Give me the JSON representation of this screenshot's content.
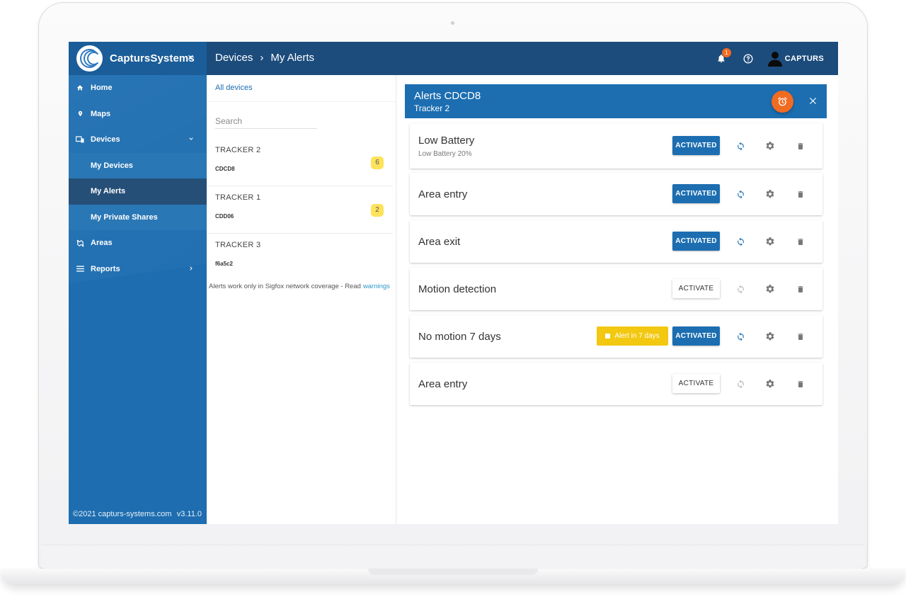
{
  "brand": {
    "name": "CaptursSystems",
    "close_glyph": "×"
  },
  "breadcrumb": {
    "items": [
      "Devices",
      "My Alerts"
    ],
    "separator": "›"
  },
  "topbar": {
    "notification_count": "1",
    "user_name": "CAPTURS"
  },
  "sidebar": {
    "items": [
      {
        "label": "Home",
        "icon": "home-icon"
      },
      {
        "label": "Maps",
        "icon": "map-pin-icon"
      },
      {
        "label": "Devices",
        "icon": "devices-icon"
      },
      {
        "label": "My Devices"
      },
      {
        "label": "My Alerts"
      },
      {
        "label": "My Private Shares"
      },
      {
        "label": "Areas",
        "icon": "areas-icon"
      },
      {
        "label": "Reports",
        "icon": "menu-lines-icon"
      }
    ],
    "footer_copyright": "©2021 capturs-systems.com",
    "footer_version": "v3.11.0"
  },
  "devices_panel": {
    "all_devices": "All devices",
    "search_placeholder": "Search",
    "devices": [
      {
        "name": "TRACKER 2",
        "id": "CDCD8",
        "alerts": "6"
      },
      {
        "name": "TRACKER 1",
        "id": "CDD06",
        "alerts": "2"
      },
      {
        "name": "TRACKER 3",
        "id": "f6a5c2"
      }
    ],
    "note": "Alerts work only in Sigfox network coverage - Read",
    "note_link": "warnings"
  },
  "alerts_panel": {
    "title": "Alerts CDCD8",
    "subtitle": "Tracker 2",
    "alerts": [
      {
        "title": "Low Battery",
        "subtitle": "Low Battery 20%",
        "state": "ACTIVATED",
        "active": true
      },
      {
        "title": "Area entry",
        "state": "ACTIVATED",
        "active": true
      },
      {
        "title": "Area exit",
        "state": "ACTIVATED",
        "active": true
      },
      {
        "title": "Motion detection",
        "state": "ACTIVATE",
        "active": false
      },
      {
        "title": "No motion 7 days",
        "pending": "Alert in 7 days",
        "state": "ACTIVATED",
        "active": true
      },
      {
        "title": "Area entry",
        "state": "ACTIVATE",
        "active": false
      }
    ]
  },
  "colors": {
    "topbar": "#1c4c7c",
    "sidebar": "#1d6db0",
    "accent": "#1c6eb1",
    "fab": "#f26b21",
    "badge": "#fde25b",
    "pending": "#f2c811"
  }
}
